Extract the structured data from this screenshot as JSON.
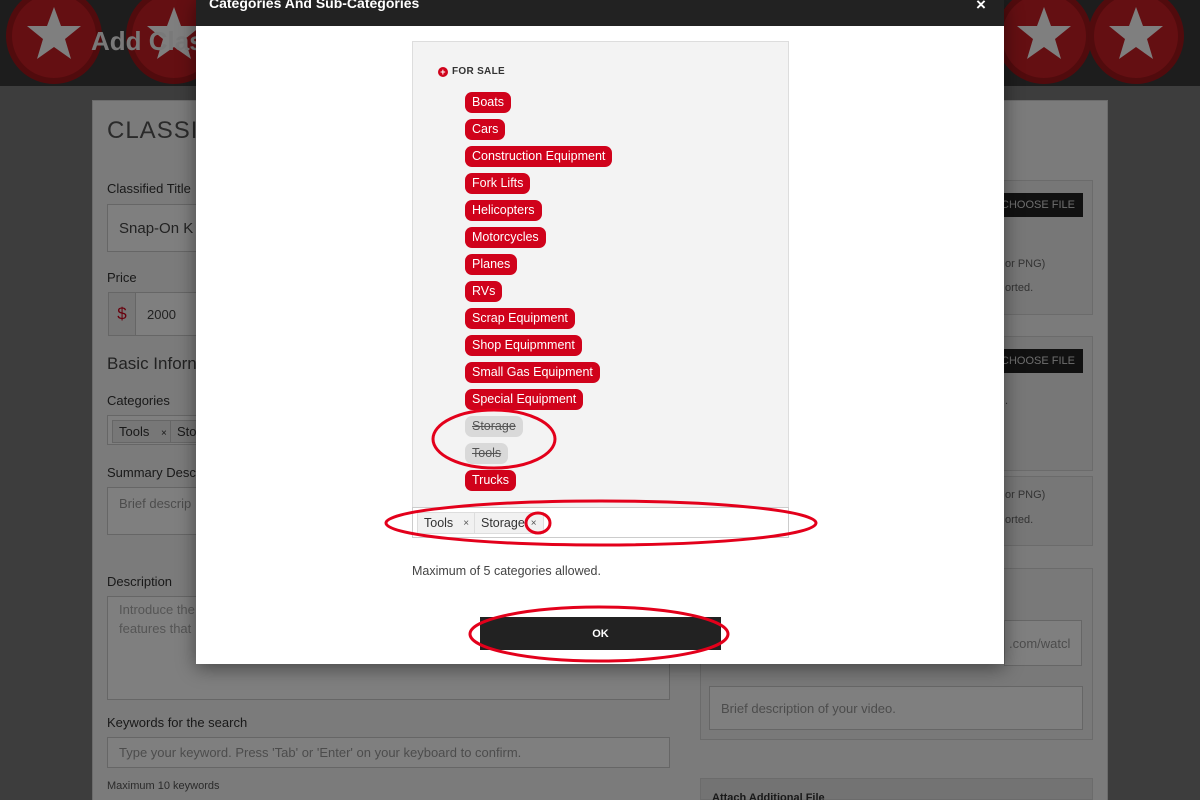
{
  "background": {
    "page_title": "Add Clas",
    "form_heading": "CLASSIF",
    "classified_title_label": "Classified Title",
    "classified_title_value": "Snap-On K",
    "price_label": "Price",
    "currency_symbol": "$",
    "price_value": "2000",
    "basic_info_heading": "Basic Inforn",
    "categories_label": "Categories",
    "category_tags": [
      {
        "label": "Tools",
        "remove": "×"
      },
      {
        "label": "Sto",
        "remove": ""
      }
    ],
    "summary_label": "Summary Descr",
    "summary_placeholder": "Brief descrip",
    "description_label": "Description",
    "description_placeholder": "Introduce the\nfeatures that",
    "keywords_label": "Keywords for the search",
    "keywords_placeholder": "Type your keyword. Press 'Tab' or 'Enter' on your keyboard to confirm.",
    "keywords_hint": "Maximum 10 keywords",
    "choose_file_1": "CHOOSE FILE",
    "choose_file_2": "CHOOSE FILE",
    "file_hint_1a": "or PNG)",
    "file_hint_1b": "orted.",
    "file_hint_2a": ".",
    "file_hint_3a": "or PNG)",
    "file_hint_3b": "orted.",
    "video_url_fragment": ".com/watcl",
    "video_desc_placeholder": "Brief description of your video.",
    "attach_label": "Attach Additional File"
  },
  "modal": {
    "title": "Categories And Sub-Categories",
    "close_label": "×",
    "group_label": "FOR SALE",
    "group_icon": "plus-circle-icon",
    "categories": [
      {
        "label": "Boats",
        "disabled": false
      },
      {
        "label": "Cars",
        "disabled": false
      },
      {
        "label": "Construction Equipment",
        "disabled": false
      },
      {
        "label": "Fork Lifts",
        "disabled": false
      },
      {
        "label": "Helicopters",
        "disabled": false
      },
      {
        "label": "Motorcycles",
        "disabled": false
      },
      {
        "label": "Planes",
        "disabled": false
      },
      {
        "label": "RVs",
        "disabled": false
      },
      {
        "label": "Scrap Equipment",
        "disabled": false
      },
      {
        "label": "Shop Equipmment",
        "disabled": false
      },
      {
        "label": "Small Gas Equipment",
        "disabled": false
      },
      {
        "label": "Special Equipment",
        "disabled": false
      },
      {
        "label": "Storage",
        "disabled": true
      },
      {
        "label": "Tools",
        "disabled": true
      },
      {
        "label": "Trucks",
        "disabled": false
      }
    ],
    "selected": [
      {
        "label": "Tools",
        "remove": "×"
      },
      {
        "label": "Storage",
        "remove": "×"
      }
    ],
    "max_note": "Maximum of 5 categories allowed.",
    "ok_label": "OK"
  },
  "colors": {
    "accent_red": "#d0021b",
    "dark": "#222222",
    "disabled_pill": "#d9d9d9",
    "annotation_red": "#e3001b"
  }
}
